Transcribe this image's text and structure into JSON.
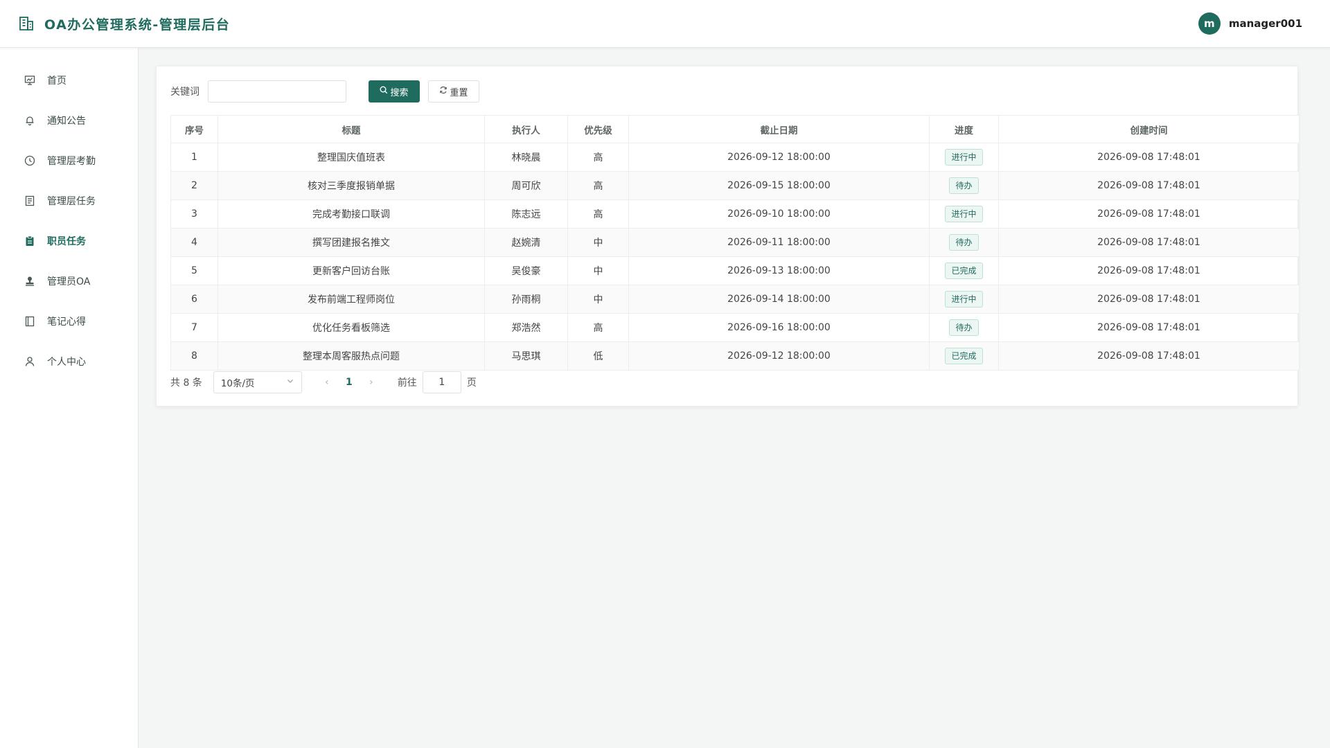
{
  "header": {
    "title": "OA办公管理系统-管理层后台",
    "user_initial": "m",
    "username": "manager001"
  },
  "sidebar": {
    "items": [
      {
        "label": "首页",
        "icon": "presentation-icon"
      },
      {
        "label": "通知公告",
        "icon": "bell-icon"
      },
      {
        "label": "管理层考勤",
        "icon": "clock-icon"
      },
      {
        "label": "管理层任务",
        "icon": "document-icon"
      },
      {
        "label": "职员任务",
        "icon": "clipboard-icon",
        "active": true
      },
      {
        "label": "管理员OA",
        "icon": "stamp-icon"
      },
      {
        "label": "笔记心得",
        "icon": "notebook-icon"
      },
      {
        "label": "个人中心",
        "icon": "user-icon"
      }
    ]
  },
  "search": {
    "label": "关键词",
    "value": "",
    "placeholder": "",
    "search_button": "搜索",
    "reset_button": "重置"
  },
  "table": {
    "columns": [
      "序号",
      "标题",
      "执行人",
      "优先级",
      "截止日期",
      "进度",
      "创建时间"
    ],
    "rows": [
      {
        "index": "1",
        "title": "整理国庆值班表",
        "assignee": "林晓晨",
        "priority": "高",
        "deadline": "2026-09-12 18:00:00",
        "status": "进行中",
        "created": "2026-09-08 17:48:01"
      },
      {
        "index": "2",
        "title": "核对三季度报销单据",
        "assignee": "周可欣",
        "priority": "高",
        "deadline": "2026-09-15 18:00:00",
        "status": "待办",
        "created": "2026-09-08 17:48:01"
      },
      {
        "index": "3",
        "title": "完成考勤接口联调",
        "assignee": "陈志远",
        "priority": "高",
        "deadline": "2026-09-10 18:00:00",
        "status": "进行中",
        "created": "2026-09-08 17:48:01"
      },
      {
        "index": "4",
        "title": "撰写团建报名推文",
        "assignee": "赵婉清",
        "priority": "中",
        "deadline": "2026-09-11 18:00:00",
        "status": "待办",
        "created": "2026-09-08 17:48:01"
      },
      {
        "index": "5",
        "title": "更新客户回访台账",
        "assignee": "吴俊豪",
        "priority": "中",
        "deadline": "2026-09-13 18:00:00",
        "status": "已完成",
        "created": "2026-09-08 17:48:01"
      },
      {
        "index": "6",
        "title": "发布前端工程师岗位",
        "assignee": "孙雨桐",
        "priority": "中",
        "deadline": "2026-09-14 18:00:00",
        "status": "进行中",
        "created": "2026-09-08 17:48:01"
      },
      {
        "index": "7",
        "title": "优化任务看板筛选",
        "assignee": "郑浩然",
        "priority": "高",
        "deadline": "2026-09-16 18:00:00",
        "status": "待办",
        "created": "2026-09-08 17:48:01"
      },
      {
        "index": "8",
        "title": "整理本周客服热点问题",
        "assignee": "马思琪",
        "priority": "低",
        "deadline": "2026-09-12 18:00:00",
        "status": "已完成",
        "created": "2026-09-08 17:48:01"
      }
    ]
  },
  "pagination": {
    "total": "共 8 条",
    "page_size": "10条/页",
    "current_page": "1",
    "goto_label": "前往",
    "goto_value": "1",
    "unit": "页"
  },
  "colors": {
    "accent": "#1f6b5e",
    "tag_bg": "#ecf6f3",
    "tag_border": "#bde0d7"
  }
}
